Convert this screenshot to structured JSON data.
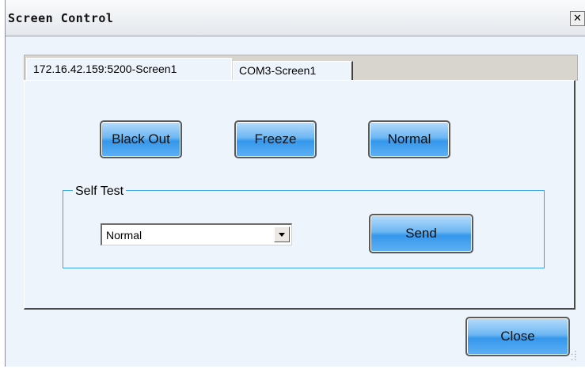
{
  "window": {
    "title": "Screen Control",
    "close_glyph": "✕"
  },
  "tabs": [
    {
      "label": "172.16.42.159:5200-Screen1",
      "active": true
    },
    {
      "label": "COM3-Screen1",
      "active": false
    }
  ],
  "controls": {
    "black_out_label": "Black Out",
    "freeze_label": "Freeze",
    "normal_label": "Normal"
  },
  "self_test": {
    "legend": "Self Test",
    "selected": "Normal",
    "send_label": "Send"
  },
  "footer": {
    "close_label": "Close"
  },
  "icons": {
    "resize_grip": "resize-grip-icon",
    "dropdown": "chevron-down-icon"
  },
  "colors": {
    "button_blue": "#3597ec",
    "window_bg": "#eef4fb",
    "group_border": "#3da3e8"
  }
}
